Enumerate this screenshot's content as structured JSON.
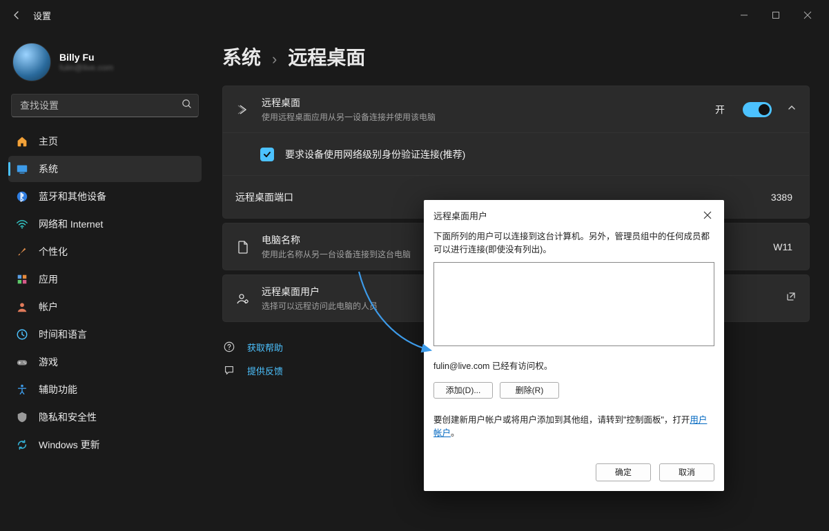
{
  "window": {
    "title": "设置"
  },
  "profile": {
    "name": "Billy Fu",
    "email": "fulin@live.com"
  },
  "search": {
    "placeholder": "查找设置"
  },
  "nav": {
    "items": [
      {
        "id": "home",
        "label": "主页"
      },
      {
        "id": "system",
        "label": "系统"
      },
      {
        "id": "bluetooth",
        "label": "蓝牙和其他设备"
      },
      {
        "id": "network",
        "label": "网络和 Internet"
      },
      {
        "id": "personalize",
        "label": "个性化"
      },
      {
        "id": "apps",
        "label": "应用"
      },
      {
        "id": "accounts",
        "label": "帐户"
      },
      {
        "id": "time",
        "label": "时间和语言"
      },
      {
        "id": "gaming",
        "label": "游戏"
      },
      {
        "id": "accessibility",
        "label": "辅助功能"
      },
      {
        "id": "privacy",
        "label": "隐私和安全性"
      },
      {
        "id": "update",
        "label": "Windows 更新"
      }
    ]
  },
  "breadcrumb": {
    "root": "系统",
    "leaf": "远程桌面"
  },
  "settings": {
    "remote": {
      "title": "远程桌面",
      "sub": "使用远程桌面应用从另一设备连接并使用该电脑",
      "toggle_label": "开",
      "toggle_on": true
    },
    "nla": {
      "label": "要求设备使用网络级别身份验证连接(推荐)",
      "checked": true
    },
    "port": {
      "label": "远程桌面端口",
      "value": "3389"
    },
    "pcname": {
      "title": "电脑名称",
      "sub": "使用此名称从另一台设备连接到这台电脑",
      "value": "W11"
    },
    "users": {
      "title": "远程桌面用户",
      "sub": "选择可以远程访问此电脑的人员"
    }
  },
  "links": {
    "help": "获取帮助",
    "feedback": "提供反馈"
  },
  "dialog": {
    "title": "远程桌面用户",
    "desc": "下面所列的用户可以连接到这台计算机。另外，管理员组中的任何成员都可以进行连接(即使没有列出)。",
    "status": "fulin@live.com 已经有访问权。",
    "add": "添加(D)...",
    "remove": "删除(R)",
    "hint_prefix": "要创建新用户帐户或将用户添加到其他组，请转到\"控制面板\"，打开",
    "hint_link": "用户帐户",
    "hint_suffix": "。",
    "ok": "确定",
    "cancel": "取消"
  }
}
